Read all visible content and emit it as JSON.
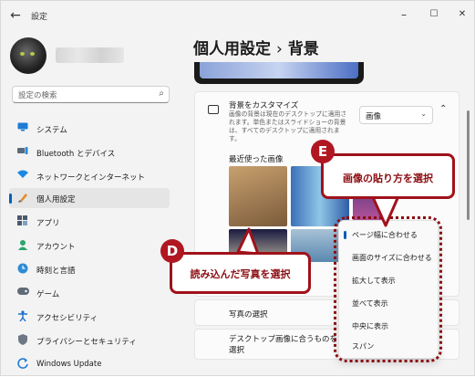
{
  "window": {
    "title": "設定",
    "minimize": "–",
    "maximize": "☐",
    "close": "✕",
    "back": "←"
  },
  "search": {
    "placeholder": "設定の検索",
    "icon": "search-icon"
  },
  "sidebar": {
    "items": [
      {
        "label": "システム",
        "icon": "monitor-icon",
        "selected": false
      },
      {
        "label": "Bluetooth とデバイス",
        "icon": "bluetooth-icon",
        "selected": false
      },
      {
        "label": "ネットワークとインターネット",
        "icon": "wifi-icon",
        "selected": false
      },
      {
        "label": "個人用設定",
        "icon": "brush-icon",
        "selected": true
      },
      {
        "label": "アプリ",
        "icon": "apps-icon",
        "selected": false
      },
      {
        "label": "アカウント",
        "icon": "person-icon",
        "selected": false
      },
      {
        "label": "時刻と言語",
        "icon": "globe-clock-icon",
        "selected": false
      },
      {
        "label": "ゲーム",
        "icon": "gamepad-icon",
        "selected": false
      },
      {
        "label": "アクセシビリティ",
        "icon": "accessibility-icon",
        "selected": false
      },
      {
        "label": "プライバシーとセキュリティ",
        "icon": "shield-icon",
        "selected": false
      },
      {
        "label": "Windows Update",
        "icon": "update-icon",
        "selected": false
      }
    ]
  },
  "page": {
    "breadcrumb_parent": "個人用設定",
    "separator": "›",
    "title": "背景"
  },
  "background_card": {
    "title": "背景をカスタマイズ",
    "description": "画像の背景は現在のデスクトップに適用されます。単色またはスライドショーの背景は、すべてのデスクトップに適用されます。",
    "dropdown_value": "画像",
    "recent_images_label": "最近使った画像",
    "choose_photo_label": "写真の選択",
    "fit_label": "デスクトップ画像に合うものを選択"
  },
  "fit_menu": {
    "items": [
      "ページ幅に合わせる",
      "画面のサイズに合わせる",
      "拡大して表示",
      "並べて表示",
      "中央に表示",
      "スパン"
    ],
    "selected_index": 0
  },
  "callouts": {
    "d": {
      "tag": "D",
      "text": "読み込んだ写真を選択"
    },
    "e": {
      "tag": "E",
      "text": "画像の貼り方を選択"
    }
  },
  "colors": {
    "accent": "#005fb8",
    "callout": "#a0121b"
  }
}
